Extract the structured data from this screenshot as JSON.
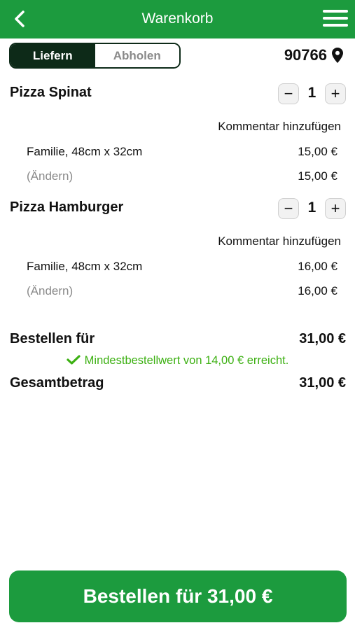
{
  "header": {
    "title": "Warenkorb"
  },
  "delivery_toggle": {
    "options": [
      "Liefern",
      "Abholen"
    ],
    "selected": "Liefern"
  },
  "postal_code": "90766",
  "cart_items": [
    {
      "name": "Pizza Spinat",
      "quantity": "1",
      "comment_link": "Kommentar hinzufügen",
      "size": "Familie, 48cm x 32cm",
      "size_price": "15,00 €",
      "change_link": "(Ändern)",
      "total": "15,00 €"
    },
    {
      "name": "Pizza Hamburger",
      "quantity": "1",
      "comment_link": "Kommentar hinzufügen",
      "size": "Familie, 48cm x 32cm",
      "size_price": "16,00 €",
      "change_link": "(Ändern)",
      "total": "16,00 €"
    }
  ],
  "summary": {
    "order_label": "Bestellen für",
    "order_value": "31,00 €",
    "minimum_message": "Mindestbestellwert von 14,00 € erreicht.",
    "total_label": "Gesamtbetrag",
    "total_value": "31,00 €"
  },
  "order_button": {
    "label": "Bestellen für 31,00 €"
  },
  "colors": {
    "brand_green": "#1c9b3e",
    "toggle_dark": "#0d2a18",
    "success_green": "#3cb012",
    "muted_gray": "#8a8a8a"
  },
  "icons": {
    "back": "chevron-left-icon",
    "menu": "hamburger-menu-icon",
    "location": "map-pin-icon",
    "success": "checkmark-icon"
  }
}
